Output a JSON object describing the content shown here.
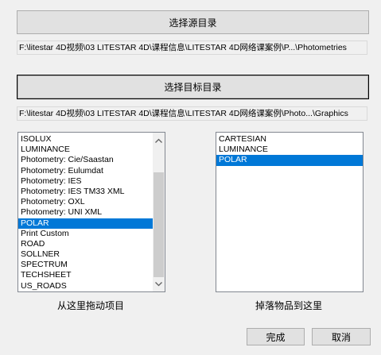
{
  "source": {
    "button_label": "选择源目录",
    "path": "F:\\litestar 4D视频\\03 LITESTAR 4D\\课程信息\\LITESTAR 4D网络课案例\\P...\\Photometries"
  },
  "target": {
    "button_label": "选择目标目录",
    "path": "F:\\litestar 4D视频\\03 LITESTAR 4D\\课程信息\\LITESTAR 4D网络课案例\\Photo...\\Graphics"
  },
  "source_list": {
    "items": [
      "ISOLUX",
      "LUMINANCE",
      "Photometry: Cie/Saastan",
      "Photometry: Eulumdat",
      "Photometry: IES",
      "Photometry: IES TM33 XML",
      "Photometry: OXL",
      "Photometry: UNI XML",
      "POLAR",
      "Print Custom",
      "ROAD",
      "SOLLNER",
      "SPECTRUM",
      "TECHSHEET",
      "US_ROADS"
    ],
    "selected": "POLAR",
    "caption": "从这里拖动项目",
    "scroll_up_icon": "chevron-up-icon",
    "scroll_down_icon": "chevron-down-icon"
  },
  "target_list": {
    "items": [
      "CARTESIAN",
      "LUMINANCE",
      "POLAR"
    ],
    "selected": "POLAR",
    "caption": "掉落物品到这里"
  },
  "footer": {
    "ok_label": "完成",
    "cancel_label": "取消"
  },
  "colors": {
    "selection": "#0078d7",
    "window_bg": "#f0f0f0",
    "button_bg": "#e1e1e1"
  }
}
